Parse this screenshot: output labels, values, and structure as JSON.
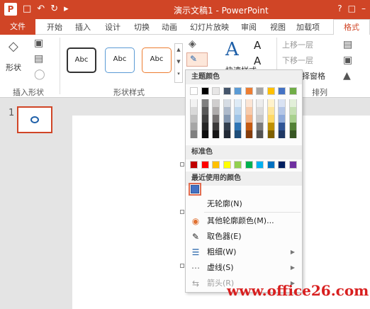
{
  "window": {
    "title": "演示文稿1 - PowerPoint"
  },
  "qat": {
    "logo": "P",
    "save_icon": "save-icon",
    "undo_icon": "undo-icon",
    "redo_icon": "repeat-icon"
  },
  "tabs": {
    "file": "文件",
    "items": [
      "开始",
      "插入",
      "设计",
      "切换",
      "动画",
      "幻灯片放映",
      "审阅",
      "视图",
      "加载项"
    ],
    "active": "格式"
  },
  "ribbon": {
    "insert_shape_group": {
      "label": "插入形状",
      "shape_button": "形状"
    },
    "shape_styles_group": {
      "label": "形状样式",
      "samples": [
        "Abc",
        "Abc",
        "Abc"
      ]
    },
    "wordart": {
      "quick_styles": "快速样式"
    },
    "arrange_group": {
      "label": "排列",
      "bring_forward": "上移一层",
      "send_backward": "下移一层",
      "selection_pane": "择窗格"
    }
  },
  "slides": {
    "number": "1"
  },
  "outline_menu": {
    "theme_colors_label": "主题颜色",
    "standard_colors_label": "标准色",
    "recent_colors_label": "最近使用的颜色",
    "items": [
      {
        "label": "无轮廓(N)",
        "icon": "",
        "submenu": false,
        "disabled": false
      },
      {
        "label": "其他轮廓颜色(M)...",
        "icon": "color-wheel-icon",
        "submenu": false,
        "disabled": false
      },
      {
        "label": "取色器(E)",
        "icon": "eyedropper-icon",
        "submenu": false,
        "disabled": false
      },
      {
        "label": "粗细(W)",
        "icon": "line-weight-icon",
        "submenu": true,
        "disabled": false
      },
      {
        "label": "虚线(S)",
        "icon": "dashes-icon",
        "submenu": true,
        "disabled": false
      },
      {
        "label": "箭头(R)",
        "icon": "arrows-icon",
        "submenu": true,
        "disabled": true
      }
    ],
    "theme_top_row": [
      "#ffffff",
      "#000000",
      "#e7e6e6",
      "#44546a",
      "#5b9bd5",
      "#ed7d31",
      "#a5a5a5",
      "#ffc000",
      "#4472c4",
      "#70ad47"
    ],
    "theme_columns": [
      [
        "#f2f2f2",
        "#d9d9d9",
        "#bfbfbf",
        "#a6a6a6",
        "#808080"
      ],
      [
        "#808080",
        "#595959",
        "#404040",
        "#262626",
        "#0d0d0d"
      ],
      [
        "#d0cece",
        "#aeabab",
        "#757171",
        "#3a3838",
        "#171616"
      ],
      [
        "#d6dce4",
        "#adb9ca",
        "#8497b0",
        "#333f4f",
        "#222a35"
      ],
      [
        "#deebf6",
        "#bdd7ee",
        "#9dc3e6",
        "#2e75b5",
        "#1f4e79"
      ],
      [
        "#fbe5d5",
        "#f7cbac",
        "#f4b183",
        "#c55a11",
        "#843c0b"
      ],
      [
        "#ededed",
        "#dbdbdb",
        "#c9c9c9",
        "#7b7b7b",
        "#525252"
      ],
      [
        "#fff2cc",
        "#fee599",
        "#ffd965",
        "#bf9000",
        "#7f6000"
      ],
      [
        "#d9e2f3",
        "#b4c6e7",
        "#8eaadb",
        "#2f5496",
        "#1f3864"
      ],
      [
        "#e2efd9",
        "#c5e0b3",
        "#a8d08d",
        "#538135",
        "#375623"
      ]
    ],
    "standard_colors": [
      "#c00000",
      "#ff0000",
      "#ffc000",
      "#ffff00",
      "#92d050",
      "#00b050",
      "#00b0f0",
      "#0070c0",
      "#002060",
      "#7030a0"
    ],
    "recent_color": "#4472c4"
  },
  "watermark": "www.office26.com",
  "accent_color": "#d04526"
}
